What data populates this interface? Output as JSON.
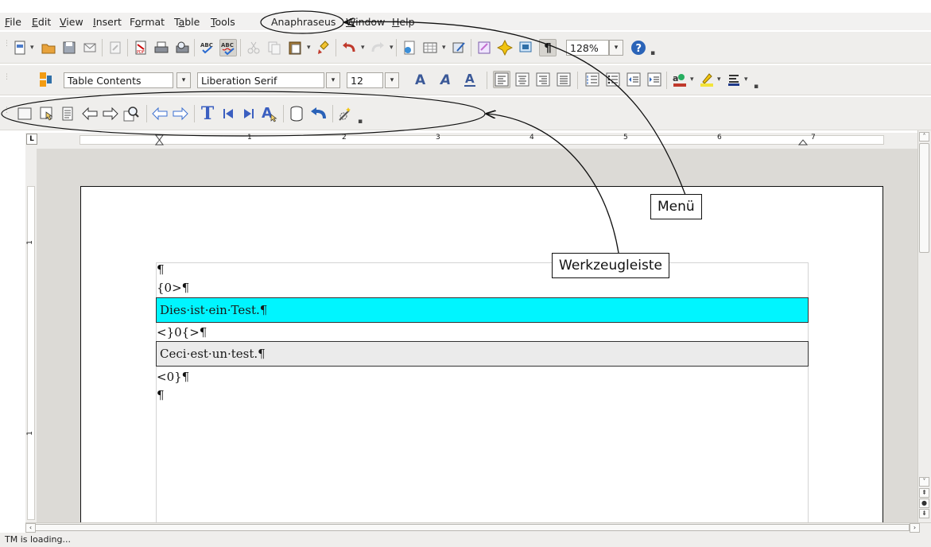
{
  "menubar": {
    "items": [
      "File",
      "Edit",
      "View",
      "Insert",
      "Format",
      "Table",
      "Tools",
      "Anaphraseus",
      "Window",
      "Help"
    ],
    "mnemonics": [
      "F",
      "E",
      "V",
      "I",
      "o",
      "a",
      "T",
      "",
      "W",
      "H"
    ]
  },
  "toolbar_standard": {
    "zoom": "128%"
  },
  "toolbar_formatting": {
    "paragraph_style": "Table Contents",
    "font_name": "Liberation Serif",
    "font_size": "12"
  },
  "document": {
    "lines": {
      "pilcrow_top": "¶",
      "open_tag": "{0>¶",
      "source_segment": "Dies·ist·ein·Test.¶",
      "middle_tag": "<}0{>¶",
      "target_segment": "Ceci·est·un·test.¶",
      "close_tag": "<0}¶",
      "pilcrow_bottom": "¶"
    },
    "source_highlight_color": "#00f5ff",
    "target_highlight_color": "#ebebeb"
  },
  "statusbar": {
    "text": "TM is loading..."
  },
  "annotations": {
    "menu_label": "Menü",
    "toolbar_label": "Werkzeugleiste"
  },
  "rulers": {
    "horizontal_numbers": [
      "1",
      "2",
      "3",
      "4",
      "5",
      "6",
      "7"
    ],
    "vertical_numbers": [
      "1",
      "1"
    ]
  }
}
